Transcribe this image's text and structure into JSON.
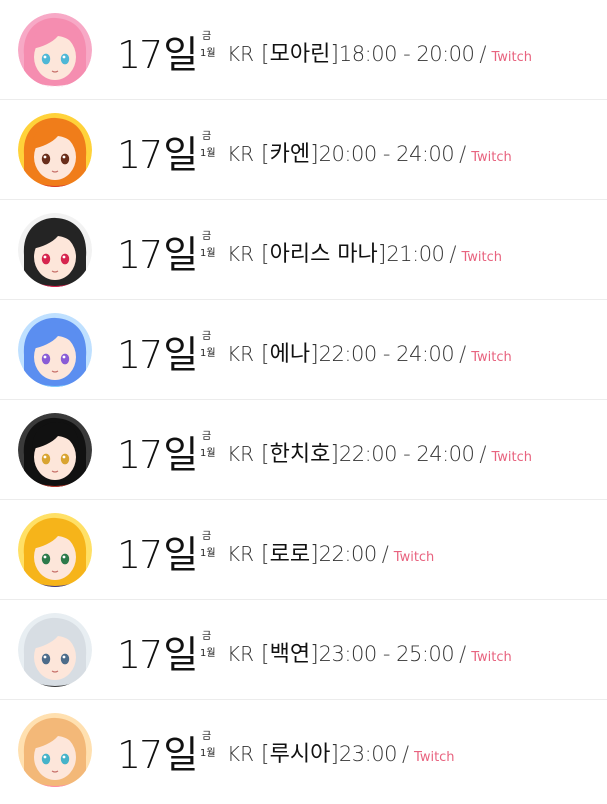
{
  "colors": {
    "accent_link": "#e8637f",
    "divider": "#ececec",
    "text": "#111111"
  },
  "schedule": [
    {
      "day": "17",
      "day_suffix": "일",
      "weekday": "금",
      "month": "1월",
      "region": "KR",
      "name": "모아린",
      "time": "18:00 - 20:00",
      "platform": "Twitch",
      "avatar": {
        "bg": "#f7a9c6",
        "hair": "#f58db0",
        "accent": "#ffffff",
        "eye": "#4fb7d6"
      }
    },
    {
      "day": "17",
      "day_suffix": "일",
      "weekday": "금",
      "month": "1월",
      "region": "KR",
      "name": "카엔",
      "time": "20:00 - 24:00",
      "platform": "Twitch",
      "avatar": {
        "bg": "#ffd23a",
        "hair": "#f07d1a",
        "accent": "#d83b2f",
        "eye": "#6a2e1a"
      }
    },
    {
      "day": "17",
      "day_suffix": "일",
      "weekday": "금",
      "month": "1월",
      "region": "KR",
      "name": "아리스 마나",
      "time": "21:00",
      "platform": "Twitch",
      "avatar": {
        "bg": "#f2f2f2",
        "hair": "#242424",
        "accent": "#e01e4b",
        "eye": "#d6254e"
      }
    },
    {
      "day": "17",
      "day_suffix": "일",
      "weekday": "금",
      "month": "1월",
      "region": "KR",
      "name": "에나",
      "time": "22:00 - 24:00",
      "platform": "Twitch",
      "avatar": {
        "bg": "#bfe0ff",
        "hair": "#5b8ef0",
        "accent": "#7fd0ff",
        "eye": "#8a5cd6"
      }
    },
    {
      "day": "17",
      "day_suffix": "일",
      "weekday": "금",
      "month": "1월",
      "region": "KR",
      "name": "한치호",
      "time": "22:00 - 24:00",
      "platform": "Twitch",
      "avatar": {
        "bg": "#3a3a3a",
        "hair": "#111111",
        "accent": "#c0392b",
        "eye": "#d9a431"
      }
    },
    {
      "day": "17",
      "day_suffix": "일",
      "weekday": "금",
      "month": "1월",
      "region": "KR",
      "name": "로로",
      "time": "22:00",
      "platform": "Twitch",
      "avatar": {
        "bg": "#ffe066",
        "hair": "#f6b41a",
        "accent": "#3b3b8f",
        "eye": "#2d7a4a"
      }
    },
    {
      "day": "17",
      "day_suffix": "일",
      "weekday": "금",
      "month": "1월",
      "region": "KR",
      "name": "백연",
      "time": "23:00 - 25:00",
      "platform": "Twitch",
      "avatar": {
        "bg": "#e8eef2",
        "hair": "#d7dde3",
        "accent": "#3a3a3a",
        "eye": "#4d6c8a"
      }
    },
    {
      "day": "17",
      "day_suffix": "일",
      "weekday": "금",
      "month": "1월",
      "region": "KR",
      "name": "루시아",
      "time": "23:00",
      "platform": "Twitch",
      "avatar": {
        "bg": "#ffe0b0",
        "hair": "#f3b878",
        "accent": "#ff8aa8",
        "eye": "#46b3c9"
      }
    }
  ]
}
